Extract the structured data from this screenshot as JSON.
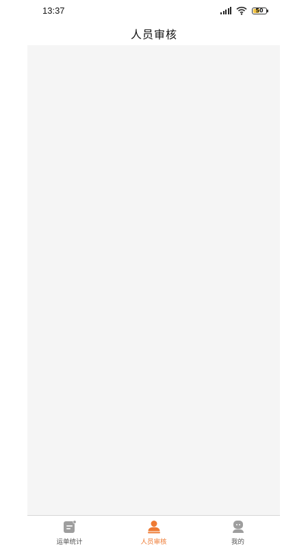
{
  "status_bar": {
    "time": "13:37",
    "battery": "50",
    "battery_level": 0.5,
    "icons": [
      "signal-icon",
      "wifi-icon",
      "battery-icon"
    ]
  },
  "header": {
    "title": "人员审核"
  },
  "bottom_nav": {
    "items": [
      {
        "label": "运单统计",
        "icon": "waybill-stats-icon",
        "active": false
      },
      {
        "label": "人员审核",
        "icon": "person-review-icon",
        "active": true
      },
      {
        "label": "我的",
        "icon": "profile-icon",
        "active": false
      }
    ]
  },
  "colors": {
    "accent": "#ee7a33",
    "inactive_icon": "#9e9e9e",
    "content_bg": "#f5f5f5"
  }
}
